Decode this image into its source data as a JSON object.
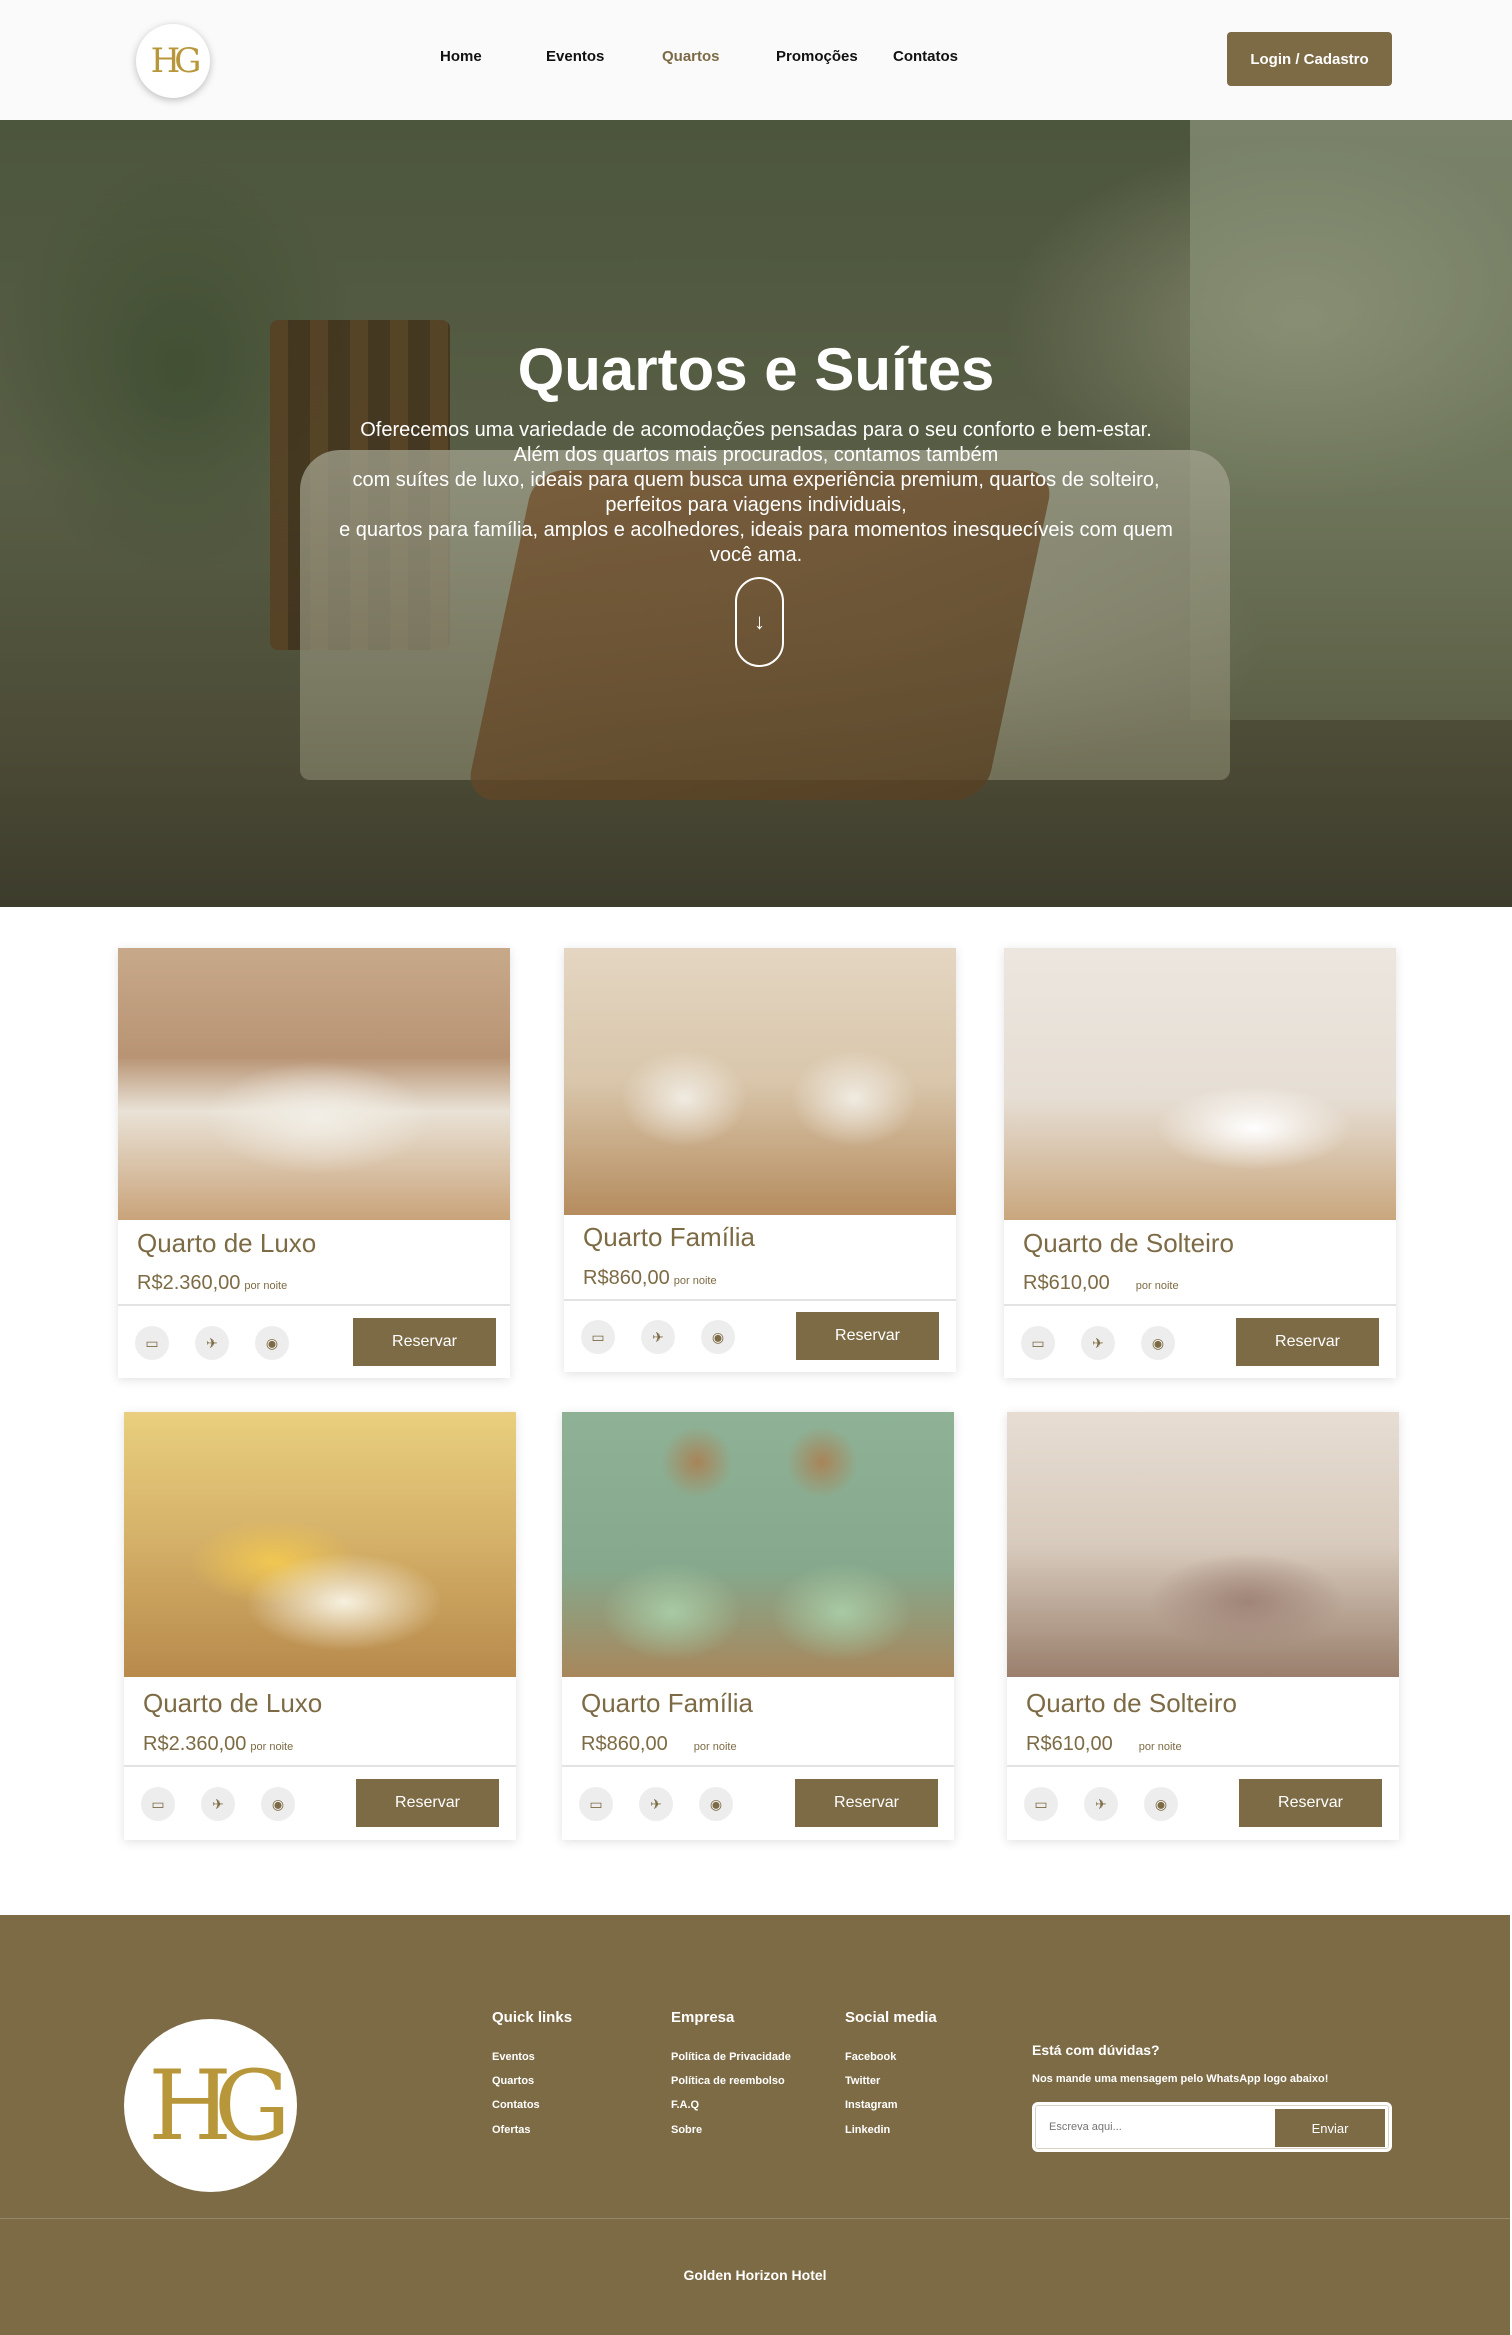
{
  "nav": {
    "logo": "HG",
    "links": [
      "Home",
      "Eventos",
      "Quartos",
      "Promoções",
      "Contatos"
    ],
    "login_label": "Login / Cadastro"
  },
  "hero": {
    "title": "Quartos e Suítes",
    "lines": [
      "Oferecemos uma variedade de acomodações pensadas para o seu conforto e bem-estar.",
      "Além dos quartos mais procurados, contamos também",
      "com suítes de luxo, ideais para quem busca uma experiência premium, quartos de solteiro,",
      "perfeitos para viagens individuais,",
      "e quartos para família, amplos e acolhedores, ideais para momentos inesquecíveis com quem",
      "você ama."
    ],
    "scroll_icon": "arrow-down-icon",
    "scroll_glyph": "↓"
  },
  "rooms": [
    {
      "name": "Quarto de Luxo",
      "price": "R$2.360,00",
      "per": "por noite",
      "button": "Reservar"
    },
    {
      "name": "Quarto Família",
      "price": "R$860,00",
      "per": "por noite",
      "button": "Reservar"
    },
    {
      "name": "Quarto de Solteiro",
      "price": "R$610,00",
      "per": "por noite",
      "button": "Reservar"
    },
    {
      "name": "Quarto de Luxo",
      "price": "R$2.360,00",
      "per": "por noite",
      "button": "Reservar"
    },
    {
      "name": "Quarto Família",
      "price": "R$860,00",
      "per": "por noite",
      "button": "Reservar"
    },
    {
      "name": "Quarto de Solteiro",
      "price": "R$610,00",
      "per": "por noite",
      "button": "Reservar"
    }
  ],
  "amenity_icons": [
    "tv-icon",
    "airplane-icon",
    "wifi-icon"
  ],
  "footer": {
    "logo": "HG",
    "quick_links": {
      "title": "Quick links",
      "items": [
        "Eventos",
        "Quartos",
        "Contatos",
        "Ofertas"
      ]
    },
    "empresa": {
      "title": "Empresa",
      "items": [
        "Política de Privacidade",
        "Política de reembolso",
        "F.A.Q",
        "Sobre"
      ]
    },
    "social": {
      "title": "Social media",
      "items": [
        "Facebook",
        "Twitter",
        "Instagram",
        "Linkedin"
      ]
    },
    "question": "Está com dúvidas?",
    "question_sub": "Nos mande uma mensagem pelo WhatsApp logo abaixo!",
    "input_placeholder": "Escreva aqui...",
    "send_label": "Enviar",
    "copyright": "Golden Horizon Hotel"
  },
  "colors": {
    "brand": "#7d6b45",
    "gold": "#b8963a"
  }
}
